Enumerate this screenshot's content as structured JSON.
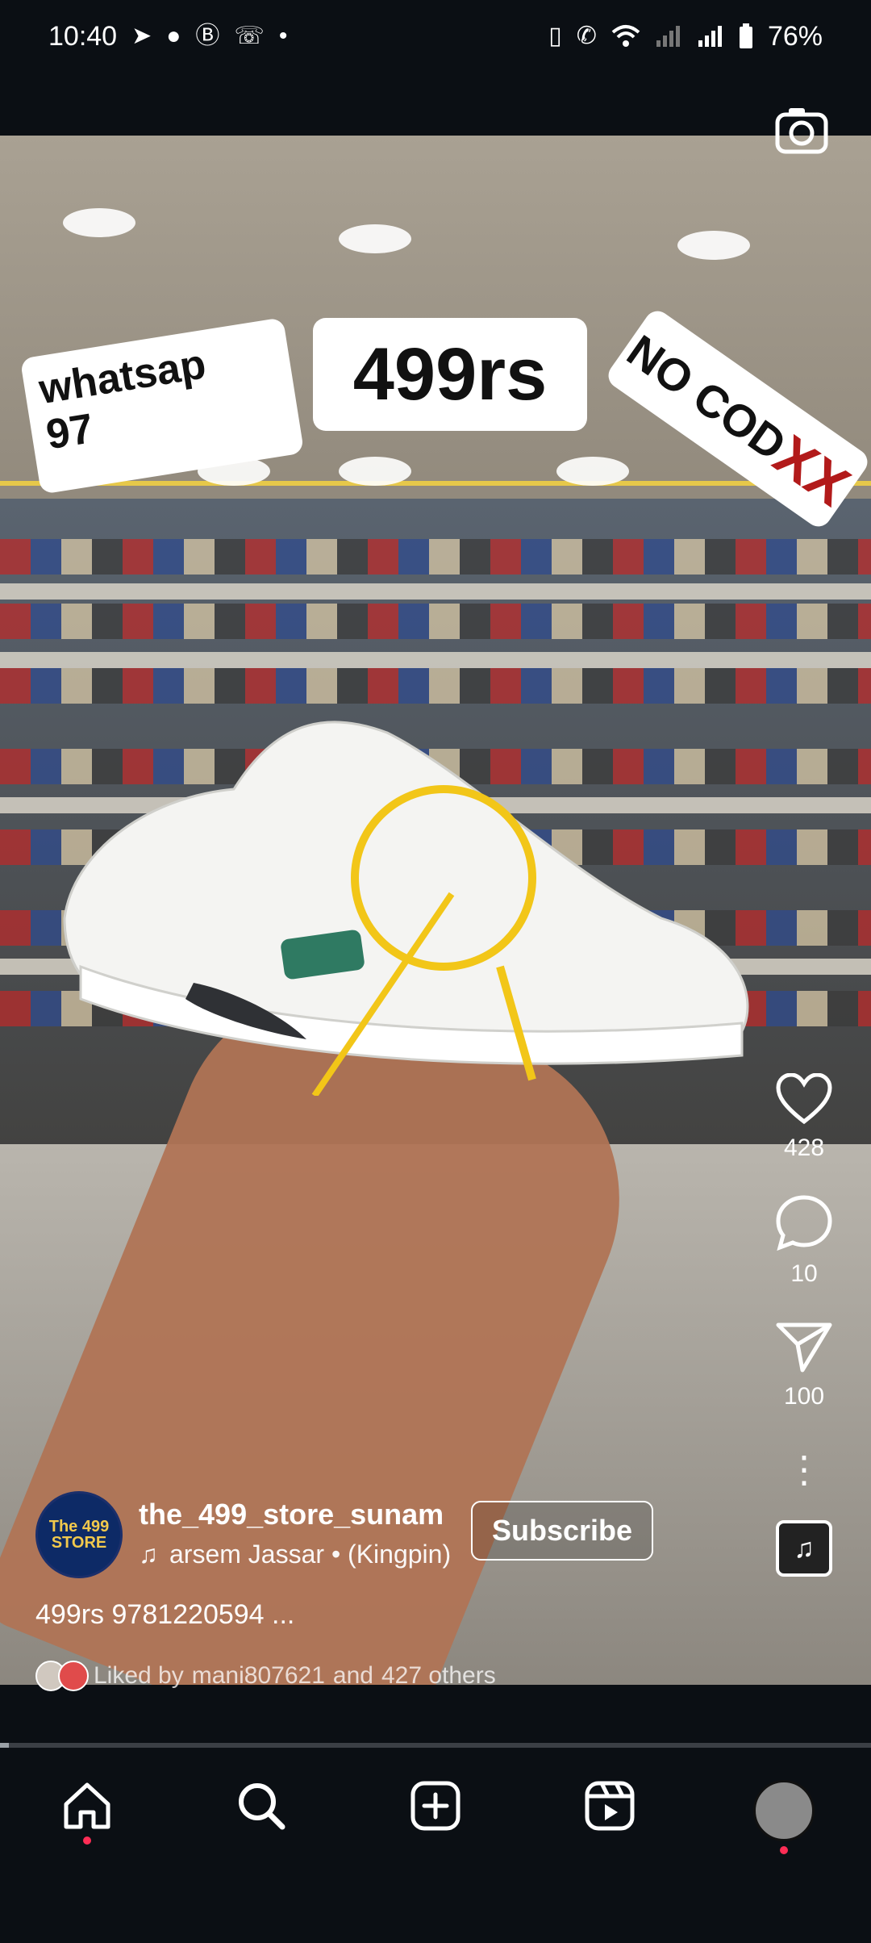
{
  "status_bar": {
    "time": "10:40",
    "battery": "76%",
    "notification_icons": [
      "telegram-icon",
      "messenger-icon",
      "beeper-icon",
      "whatsapp-icon",
      "dot-icon"
    ],
    "system_icons": [
      "vibrate-icon",
      "volte-call-icon",
      "wifi-icon",
      "signal-icon",
      "signal-icon",
      "battery-icon"
    ]
  },
  "video": {
    "stickers": {
      "price": "499rs",
      "whatsapp": "whatsap\n97",
      "no_cod": "NO COD",
      "no_cod_marks": "XX"
    }
  },
  "actions": {
    "likes": "428",
    "comments": "10",
    "shares": "100"
  },
  "creator": {
    "avatar_text": "The 499 STORE",
    "username": "the_499_store_sunam",
    "subscribe_label": "Subscribe",
    "audio_text": "arsem Jassar • (Kingpin)"
  },
  "caption": "499rs 9781220594 ...",
  "liked_by": {
    "prefix": "Liked by",
    "user": "mani807621",
    "connector": "and",
    "others": "427 others"
  },
  "progress": {
    "fraction": 0.01
  },
  "bottom_nav": {
    "items": [
      "home",
      "search",
      "create",
      "reels",
      "profile"
    ]
  },
  "colors": {
    "nav_badge": "#ff2d55",
    "nocod_marks": "#b21a1a"
  }
}
